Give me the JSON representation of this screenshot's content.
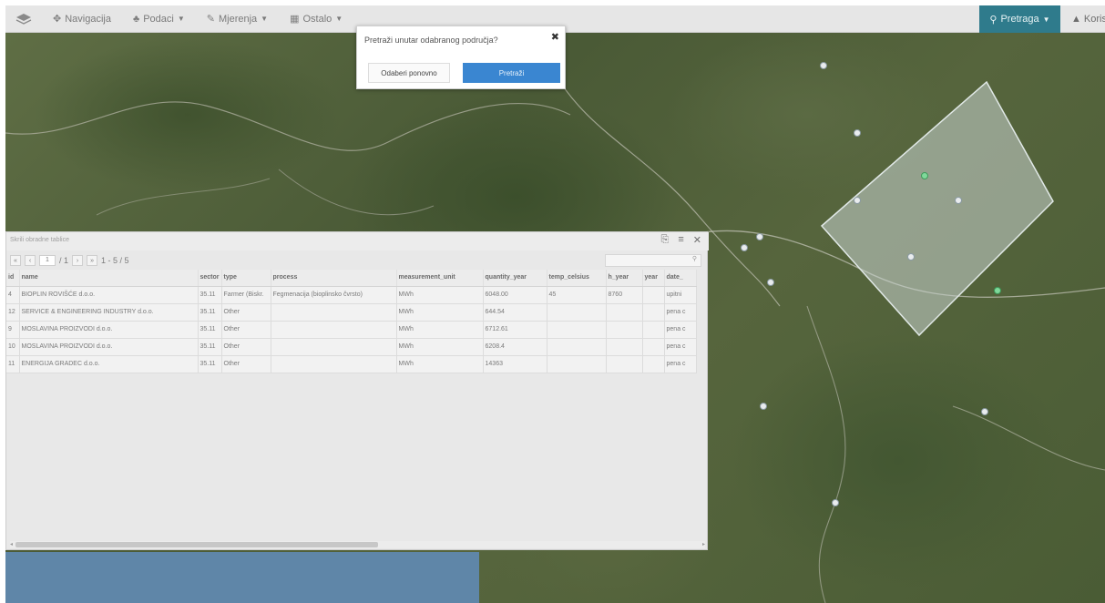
{
  "topbar": {
    "logo_icon": "layers-icon",
    "items": [
      {
        "icon": "crosshair-icon",
        "label": "Navigacija",
        "caret": false
      },
      {
        "icon": "shapes-icon",
        "label": "Podaci",
        "caret": true
      },
      {
        "icon": "pencil-icon",
        "label": "Mjerenja",
        "caret": true
      },
      {
        "icon": "grid-icon",
        "label": "Ostalo",
        "caret": true
      }
    ],
    "search_label": "Pretraga",
    "search_icon": "search-icon",
    "user_label": "Korisn",
    "user_icon": "user-icon",
    "accent": "#2f7b8c"
  },
  "popup": {
    "title": "Pretraži unutar odabranog područja?",
    "cancel_label": "Odaberi ponovno",
    "search_label": "Pretraži",
    "close_icon": "close-icon",
    "accent": "#3a86d1"
  },
  "panel": {
    "title": "Skrili obradne tablice",
    "tools": [
      "export-icon",
      "menu-icon",
      "close-icon"
    ],
    "page_value": "1",
    "page_total": "/ 1",
    "range": "1 - 5 / 5",
    "columns": [
      "id",
      "name",
      "sector",
      "type",
      "process",
      "measurement_unit",
      "quantity_year",
      "temp_celsius",
      "h_year",
      "year",
      "date_"
    ],
    "rows": [
      [
        "4",
        "BIOPLIN ROVIŠĆE d.o.o.",
        "35.11",
        "Farmer (Biskr.",
        "Fegmenacija (bioplinsko čvrsto)",
        "MWh",
        "6048.00",
        "45",
        "8760",
        "",
        "upitni"
      ],
      [
        "12",
        "SERVICE & ENGINEERING INDUSTRY d.o.o.",
        "35.11",
        "Other",
        "",
        "MWh",
        "644.54",
        "",
        "",
        "",
        "pena c"
      ],
      [
        "9",
        "MOSLAVINA PROIZVODI d.o.o.",
        "35.11",
        "Other",
        "",
        "MWh",
        "6712.61",
        "",
        "",
        "",
        "pena c"
      ],
      [
        "10",
        "MOSLAVINA PROIZVODI d.o.o.",
        "35.11",
        "Other",
        "",
        "MWh",
        "6208.4",
        "",
        "",
        "",
        "pena c"
      ],
      [
        "11",
        "ENERGIJA GRADEC d.o.o.",
        "35.11",
        "Other",
        "",
        "MWh",
        "14363",
        "",
        "",
        "",
        "pena c"
      ]
    ]
  }
}
